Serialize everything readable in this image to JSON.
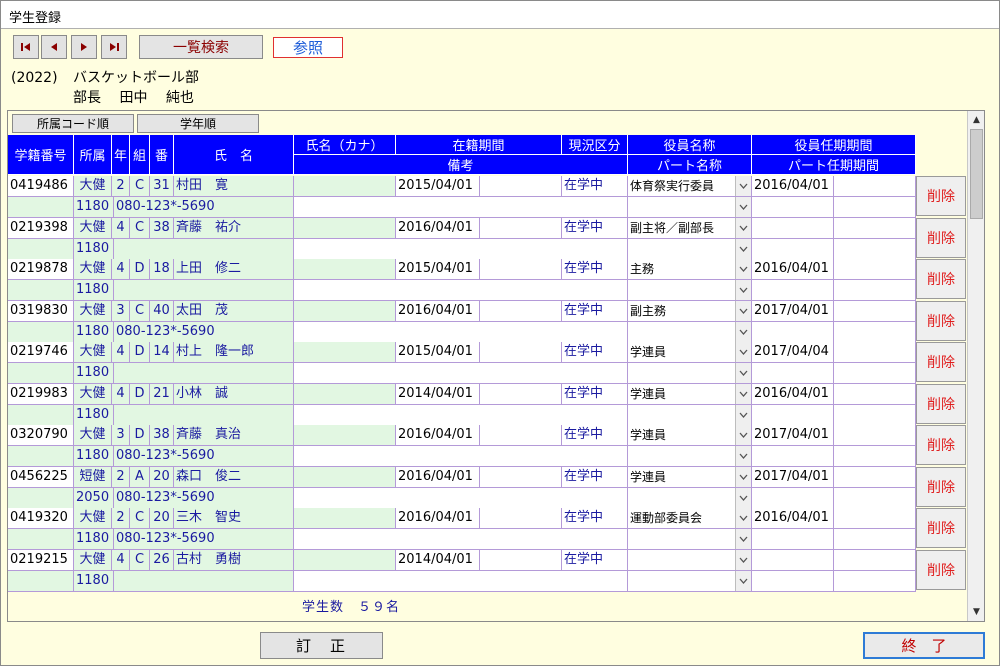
{
  "window": {
    "title": "学生登録"
  },
  "toolbar": {
    "search_label": "一覧検索",
    "ref_label": "参照"
  },
  "club": {
    "year": "(2022)",
    "name": "バスケットボール部",
    "head_title": "部長",
    "head_last": "田中",
    "head_first": "純也"
  },
  "sort": {
    "by_code": "所属コード順",
    "by_grade": "学年順"
  },
  "headers": {
    "student_no": "学籍番号",
    "dept": "所属",
    "year": "年",
    "group": "組",
    "num": "番",
    "name": "氏　名",
    "kana": "氏名（カナ）",
    "period": "在籍期間",
    "status": "現況区分",
    "role": "役員名称",
    "role_period": "役員任期期間",
    "note": "備考",
    "part": "パート名称",
    "part_period": "パート任期期間"
  },
  "students": [
    {
      "id": "0419486",
      "dept": "大健",
      "year": "2",
      "group": "C",
      "num": "31",
      "name": "村田　寛",
      "start": "2015/04/01",
      "status": "在学中",
      "role": "体育祭実行委員",
      "role_start": "2016/04/01",
      "code": "1180",
      "phone": "080-123*-5690"
    },
    {
      "id": "0219398",
      "dept": "大健",
      "year": "4",
      "group": "C",
      "num": "38",
      "name": "斉藤　祐介",
      "start": "2016/04/01",
      "status": "在学中",
      "role": "副主将／副部長",
      "role_start": "",
      "code": "1180",
      "phone": ""
    },
    {
      "id": "0219878",
      "dept": "大健",
      "year": "4",
      "group": "D",
      "num": "18",
      "name": "上田　修二",
      "start": "2015/04/01",
      "status": "在学中",
      "role": "主務",
      "role_start": "2016/04/01",
      "code": "1180",
      "phone": ""
    },
    {
      "id": "0319830",
      "dept": "大健",
      "year": "3",
      "group": "C",
      "num": "40",
      "name": "太田　茂",
      "start": "2016/04/01",
      "status": "在学中",
      "role": "副主務",
      "role_start": "2017/04/01",
      "code": "1180",
      "phone": "080-123*-5690"
    },
    {
      "id": "0219746",
      "dept": "大健",
      "year": "4",
      "group": "D",
      "num": "14",
      "name": "村上　隆一郎",
      "start": "2015/04/01",
      "status": "在学中",
      "role": "学連員",
      "role_start": "2017/04/04",
      "code": "1180",
      "phone": ""
    },
    {
      "id": "0219983",
      "dept": "大健",
      "year": "4",
      "group": "D",
      "num": "21",
      "name": "小林　誠",
      "start": "2014/04/01",
      "status": "在学中",
      "role": "学連員",
      "role_start": "2016/04/01",
      "code": "1180",
      "phone": ""
    },
    {
      "id": "0320790",
      "dept": "大健",
      "year": "3",
      "group": "D",
      "num": "38",
      "name": "斉藤　真治",
      "start": "2016/04/01",
      "status": "在学中",
      "role": "学連員",
      "role_start": "2017/04/01",
      "code": "1180",
      "phone": "080-123*-5690"
    },
    {
      "id": "0456225",
      "dept": "短健",
      "year": "2",
      "group": "A",
      "num": "20",
      "name": "森口　俊二",
      "start": "2016/04/01",
      "status": "在学中",
      "role": "学連員",
      "role_start": "2017/04/01",
      "code": "2050",
      "phone": "080-123*-5690"
    },
    {
      "id": "0419320",
      "dept": "大健",
      "year": "2",
      "group": "C",
      "num": "20",
      "name": "三木　智史",
      "start": "2016/04/01",
      "status": "在学中",
      "role": "運動部委員会",
      "role_start": "2016/04/01",
      "code": "1180",
      "phone": "080-123*-5690"
    },
    {
      "id": "0219215",
      "dept": "大健",
      "year": "4",
      "group": "C",
      "num": "26",
      "name": "古村　勇樹",
      "start": "2014/04/01",
      "status": "在学中",
      "role": "",
      "role_start": "",
      "code": "1180",
      "phone": ""
    }
  ],
  "delete_label": "削除",
  "footer": {
    "count_text": "学生数　５９名",
    "fix_label": "訂　正",
    "end_label": "終　了"
  }
}
